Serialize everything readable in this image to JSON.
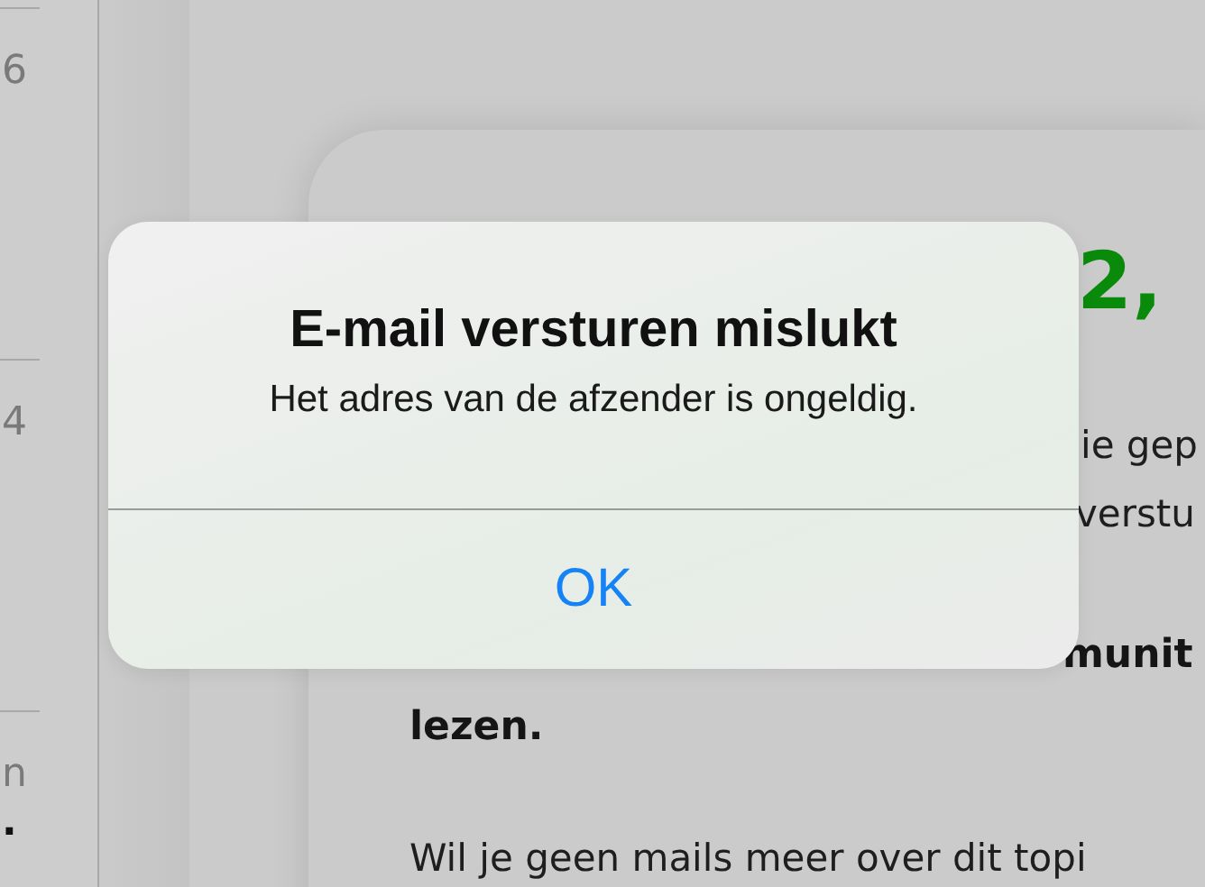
{
  "sidebar": {
    "items": [
      {
        "label": "6"
      },
      {
        "label": "4"
      },
      {
        "label": "n"
      },
      {
        "label": "."
      }
    ]
  },
  "post": {
    "heading": "2,",
    "line_1": "ie gep",
    "line_2": "verstu",
    "bold_line_1": "munit",
    "bold_line_2": "lezen.",
    "footer": "Wil je geen mails meer over dit topi"
  },
  "alert": {
    "title": "E-mail versturen mislukt",
    "message": "Het adres van de afzender is ongeldig.",
    "buttons": [
      "OK"
    ]
  }
}
